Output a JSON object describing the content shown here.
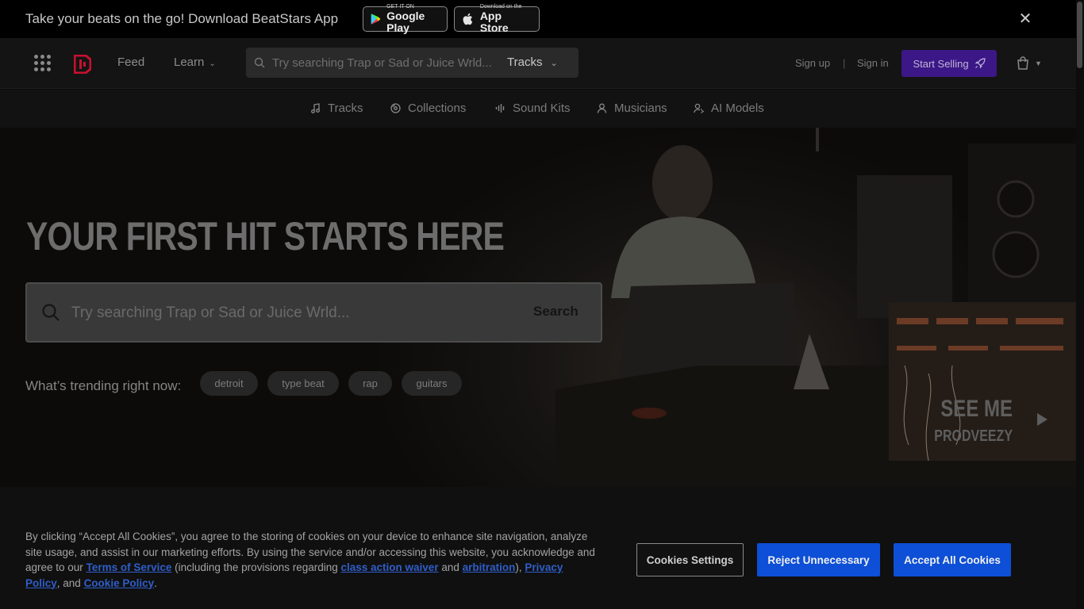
{
  "promo": {
    "text": "Take your beats on the go! Download BeatStars App",
    "google_play_small": "GET IT ON",
    "google_play_large": "Google Play",
    "app_store_small": "Download on the",
    "app_store_large": "App Store",
    "close_glyph": "✕"
  },
  "header": {
    "feed": "Feed",
    "learn": "Learn",
    "search_placeholder": "Try searching Trap or Sad or Juice Wrld...",
    "search_type": "Tracks",
    "sign_up": "Sign up",
    "separator": "|",
    "sign_in": "Sign in",
    "start_selling": "Start Selling"
  },
  "categories": [
    {
      "label": "Tracks",
      "icon": "music-note-icon"
    },
    {
      "label": "Collections",
      "icon": "collections-icon"
    },
    {
      "label": "Sound Kits",
      "icon": "waveform-icon"
    },
    {
      "label": "Musicians",
      "icon": "user-icon"
    },
    {
      "label": "AI Models",
      "icon": "ai-voice-icon"
    }
  ],
  "hero": {
    "title": "YOUR FIRST HIT STARTS HERE",
    "search_placeholder": "Try searching Trap or Sad or Juice Wrld...",
    "search_button": "Search",
    "trending_label": "What’s trending right now:",
    "trending": [
      "detroit",
      "type beat",
      "rap",
      "guitars"
    ],
    "feature_title": "SEE ME",
    "feature_artist": "PRODVEEZY"
  },
  "cookie": {
    "text_1": "By clicking “Accept All Cookies”, you agree to the storing of cookies on your device to enhance site navigation, analyze site usage, and assist in our marketing efforts. By using the service and/or accessing this website, you acknowledge and agree to our ",
    "terms": "Terms of Service",
    "text_2": " (including the provisions regarding ",
    "class_action": "class action waiver",
    "text_3": " and ",
    "arbitration": "arbitration",
    "text_4": "), ",
    "privacy": "Privacy Policy",
    "text_5": ", and ",
    "cookie_policy": "Cookie Policy",
    "text_6": ".",
    "settings_button": "Cookies Settings",
    "reject_button": "Reject Unnecessary",
    "accept_button": "Accept All Cookies"
  },
  "colors": {
    "accent_purple": "#3c1787",
    "cookie_blue": "#0d4fd6",
    "link_blue": "#2f5ec9",
    "logo_red": "#c8102e"
  }
}
